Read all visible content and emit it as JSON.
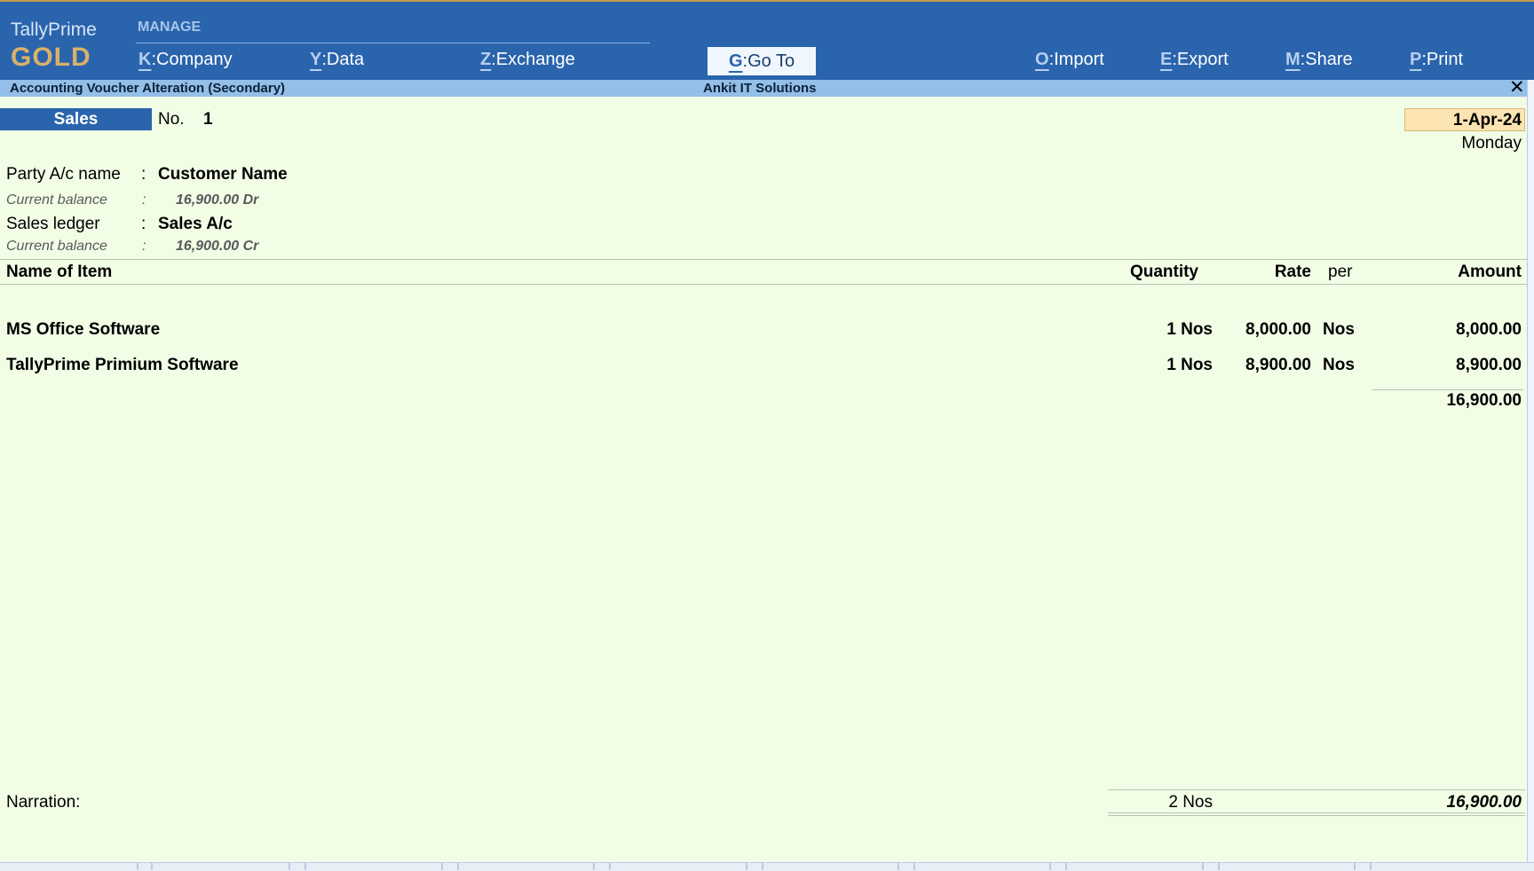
{
  "app": {
    "brand_name": "TallyPrime",
    "brand_tier": "GOLD",
    "manage_label": "MANAGE"
  },
  "menu": {
    "company": {
      "key": "K",
      "label": "Company"
    },
    "data": {
      "key": "Y",
      "label": "Data"
    },
    "exchange": {
      "key": "Z",
      "label": "Exchange"
    },
    "goto": {
      "key": "G",
      "label": "Go To"
    },
    "import": {
      "key": "O",
      "label": "Import"
    },
    "export": {
      "key": "E",
      "label": "Export"
    },
    "share": {
      "key": "M",
      "label": "Share"
    },
    "print": {
      "key": "P",
      "label": "Print"
    }
  },
  "titlebar": {
    "left": "Accounting Voucher Alteration (Secondary)",
    "center": "Ankit IT Solutions",
    "close_glyph": "✕"
  },
  "voucher": {
    "type": "Sales",
    "no_label": "No.",
    "no": "1",
    "date": "1-Apr-24",
    "day": "Monday",
    "party_label": "Party A/c name",
    "party_value": "Customer Name",
    "party_balance_label": "Current balance",
    "party_balance": "16,900.00 Dr",
    "ledger_label": "Sales ledger",
    "ledger_value": "Sales A/c",
    "ledger_balance_label": "Current balance",
    "ledger_balance": "16,900.00 Cr",
    "colon": ":"
  },
  "table": {
    "headers": {
      "item": "Name of Item",
      "quantity": "Quantity",
      "rate": "Rate",
      "per": "per",
      "amount": "Amount"
    },
    "rows": [
      {
        "item": "MS Office Software",
        "quantity": "1 Nos",
        "rate": "8,000.00",
        "per": "Nos",
        "amount": "8,000.00"
      },
      {
        "item": "TallyPrime Primium Software",
        "quantity": "1 Nos",
        "rate": "8,900.00",
        "per": "Nos",
        "amount": "8,900.00"
      }
    ],
    "subtotal": "16,900.00"
  },
  "footer": {
    "narration_label": "Narration:",
    "total_qty": "2 Nos",
    "total_amount": "16,900.00"
  },
  "colors": {
    "header_blue": "#2a64ad",
    "content_bg": "#f2fde6",
    "title_bar": "#93bfe8",
    "date_bg": "#fce4b2",
    "brand_gold": "#d9b16a"
  }
}
